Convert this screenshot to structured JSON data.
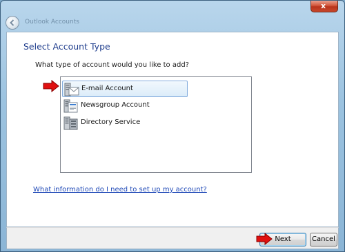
{
  "window": {
    "title": "Outlook Accounts",
    "close_glyph": "x",
    "back_icon": "back-arrow-icon"
  },
  "page": {
    "heading": "Select Account Type",
    "question": "What type of account would you like to add?"
  },
  "account_types": [
    {
      "label": "E-mail Account",
      "icon": "email-account-icon",
      "selected": true
    },
    {
      "label": "Newsgroup Account",
      "icon": "newsgroup-account-icon",
      "selected": false
    },
    {
      "label": "Directory Service",
      "icon": "directory-service-icon",
      "selected": false
    }
  ],
  "help_link": "What information do I need to set up my account?",
  "buttons": {
    "next": "Next",
    "cancel": "Cancel"
  },
  "colors": {
    "heading": "#1e3c8c",
    "link": "#1f49b7",
    "annotation_arrow": "#e01010",
    "selection_border": "#84acdd"
  }
}
